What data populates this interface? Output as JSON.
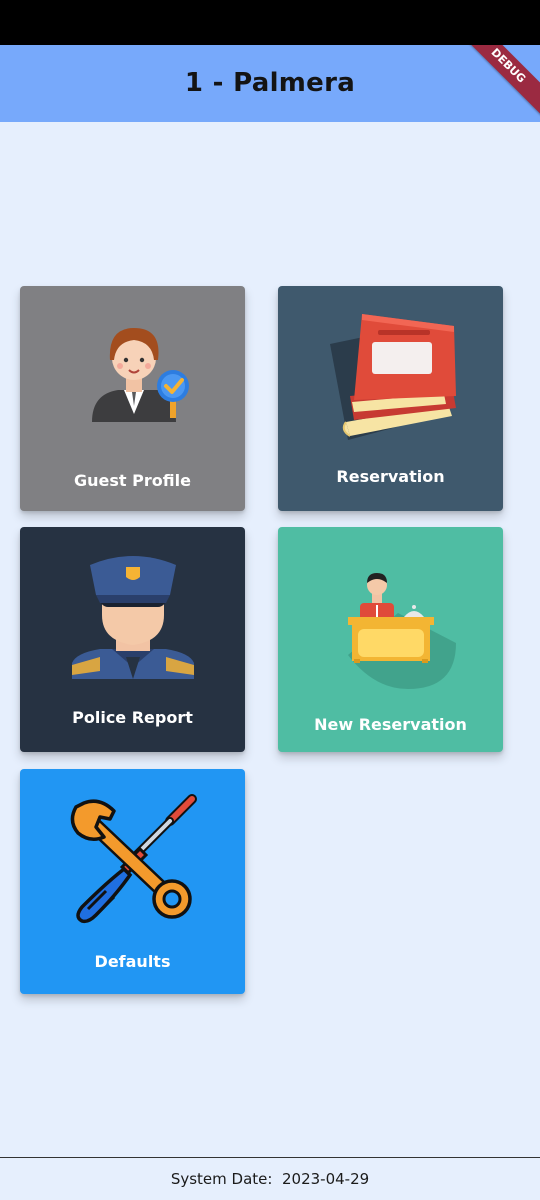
{
  "app_bar": {
    "title": "1 - Palmera",
    "debug_label": "DEBUG"
  },
  "tiles": [
    {
      "label": "Guest Profile",
      "color": "#808083",
      "icon": "guest-profile-icon"
    },
    {
      "label": "Reservation",
      "color": "#3f596d",
      "icon": "reservation-book-icon"
    },
    {
      "label": "Police Report",
      "color": "#263242",
      "icon": "police-officer-icon"
    },
    {
      "label": "New Reservation",
      "color": "#4fbda3",
      "icon": "reception-desk-icon"
    },
    {
      "label": "Defaults",
      "color": "#2196f3",
      "icon": "wrench-screwdriver-icon"
    }
  ],
  "footer": {
    "label": "System Date:",
    "date": "2023-04-29"
  }
}
